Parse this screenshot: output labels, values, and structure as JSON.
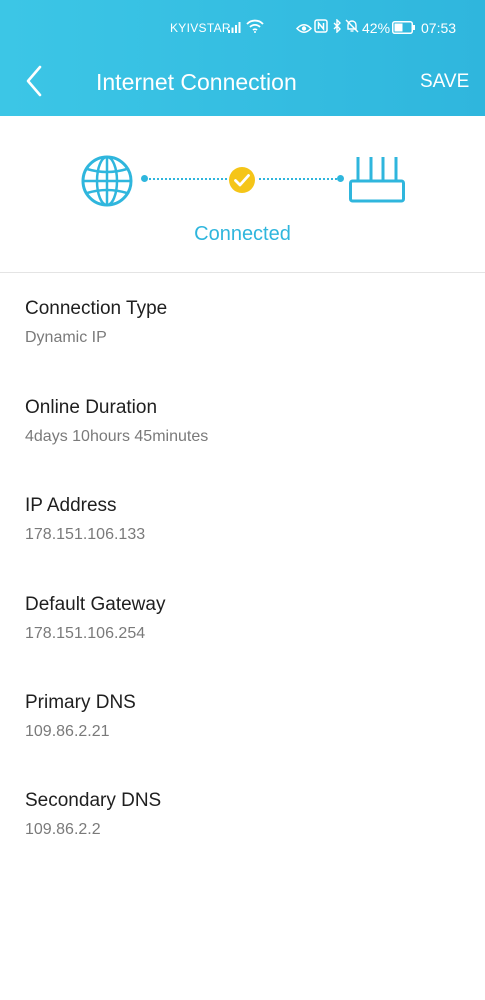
{
  "status_bar": {
    "carrier": "KYIVSTAR",
    "battery": "42%",
    "time": "07:53"
  },
  "header": {
    "title": "Internet Connection",
    "save_label": "SAVE"
  },
  "connection_status": {
    "label": "Connected",
    "accent_color": "#2fb6dd",
    "check_color": "#f5c518"
  },
  "details": [
    {
      "label": "Connection Type",
      "value": "Dynamic IP"
    },
    {
      "label": "Online Duration",
      "value": "4days 10hours 45minutes"
    },
    {
      "label": "IP Address",
      "value": "178.151.106.133"
    },
    {
      "label": "Default Gateway",
      "value": "178.151.106.254"
    },
    {
      "label": "Primary DNS",
      "value": "109.86.2.21"
    },
    {
      "label": "Secondary DNS",
      "value": "109.86.2.2"
    }
  ]
}
